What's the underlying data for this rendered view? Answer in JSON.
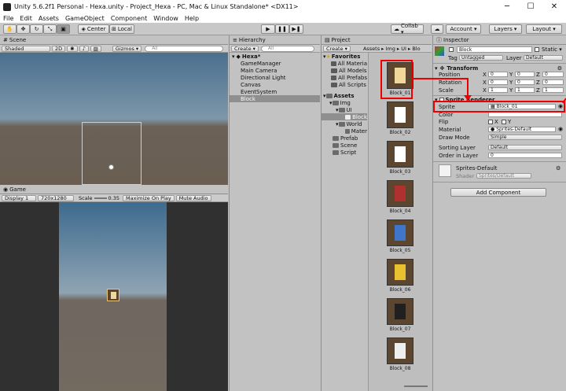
{
  "window": {
    "title": "Unity 5.6.2f1 Personal - Hexa.unity - Project_Hexa - PC, Mac & Linux Standalone* <DX11>",
    "minimize": "─",
    "maximize": "☐",
    "close": "✕"
  },
  "menu": [
    "File",
    "Edit",
    "Assets",
    "GameObject",
    "Component",
    "Window",
    "Help"
  ],
  "toolbar": {
    "center_label": "Center",
    "local_label": "Local",
    "collab_label": "Collab ▾",
    "account_label": "Account ▾",
    "layers_label": "Layers ▾",
    "layout_label": "Layout ▾",
    "play_icon": "▶",
    "pause_icon": "❚❚",
    "step_icon": "▶❚"
  },
  "scene": {
    "tab_label": "Scene",
    "shaded_label": "Shaded",
    "mode_2d": "2D",
    "gizmos_label": "Gizmos ▾",
    "search_placeholder": "All"
  },
  "game": {
    "tab_label": "Game",
    "display_label": "Display 1",
    "resolution_label": "720x1280",
    "scale_label": "Scale",
    "scale_value": "0.35",
    "maximize_label": "Maximize On Play",
    "mute_label": "Mute Audio",
    "stats_label": "Stats"
  },
  "hierarchy": {
    "tab_label": "Hierarchy",
    "create_label": "Create ▾",
    "search_placeholder": "All",
    "scene_name": "Hexa*",
    "items": [
      "GameManager",
      "Main Camera",
      "Directional Light",
      "Canvas",
      "EventSystem",
      "Block"
    ],
    "selected_index": 5
  },
  "project": {
    "tab_label": "Project",
    "create_label": "Create ▾",
    "breadcrumb": "Assets ▸ Img ▸ UI ▸ Blo",
    "favorites_label": "Favorites",
    "favorites": [
      "All Materia",
      "All Models",
      "All Prefabs",
      "All Scripts"
    ],
    "assets_label": "Assets",
    "tree": [
      {
        "label": "Img",
        "indent": 1
      },
      {
        "label": "UI",
        "indent": 2
      },
      {
        "label": "Block",
        "indent": 3
      },
      {
        "label": "World",
        "indent": 2
      },
      {
        "label": "Mater",
        "indent": 3
      },
      {
        "label": "Prefab",
        "indent": 1
      },
      {
        "label": "Scene",
        "indent": 1
      },
      {
        "label": "Script",
        "indent": 1
      }
    ],
    "assets": [
      {
        "label": "Block_01",
        "color": "#f0d79a"
      },
      {
        "label": "Block_02",
        "color": "#ffffff"
      },
      {
        "label": "Block_03",
        "color": "#ffffff"
      },
      {
        "label": "Block_04",
        "color": "#b03030"
      },
      {
        "label": "Block_05",
        "color": "#3f76c9"
      },
      {
        "label": "Block_06",
        "color": "#e8c030"
      },
      {
        "label": "Block_07",
        "color": "#202020"
      },
      {
        "label": "Block_08",
        "color": "#eeeeee"
      }
    ]
  },
  "inspector": {
    "tab_label": "Inspector",
    "object_name": "Block",
    "static_label": "Static ▾",
    "tag_label": "Tag",
    "tag_value": "Untagged",
    "layer_label": "Layer",
    "layer_value": "Default",
    "transform_label": "Transform",
    "position_label": "Position",
    "rotation_label": "Rotation",
    "scale_label": "Scale",
    "position": [
      "0",
      "0",
      "0"
    ],
    "rotation": [
      "0",
      "0",
      "0"
    ],
    "scale": [
      "1",
      "1",
      "1"
    ],
    "axis_x": "X",
    "axis_y": "Y",
    "axis_z": "Z",
    "sprite_renderer_label": "Sprite Renderer",
    "sprite_label": "Sprite",
    "sprite_value": "Block_01",
    "color_label": "Color",
    "flip_label": "Flip",
    "flip_x": "X",
    "flip_y": "Y",
    "material_label": "Material",
    "material_value": "Sprites-Default",
    "draw_mode_label": "Draw Mode",
    "draw_mode_value": "Simple",
    "sorting_layer_label": "Sorting Layer",
    "sorting_layer_value": "Default",
    "order_label": "Order in Layer",
    "order_value": "0",
    "material_name": "Sprites-Default",
    "shader_label": "Shader",
    "shader_value": "Sprites/Default",
    "add_component_label": "Add Component"
  }
}
